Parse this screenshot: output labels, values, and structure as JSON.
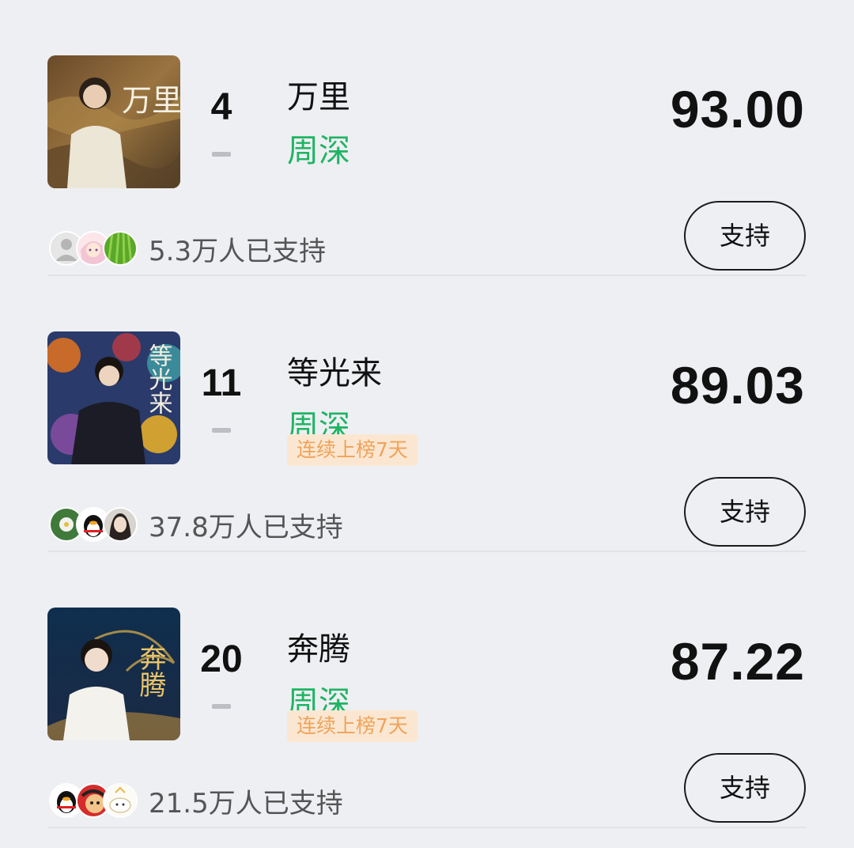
{
  "items": [
    {
      "rank": "4",
      "title": "万里",
      "artist": "周深",
      "streak": "",
      "score": "93.00",
      "supporters": "5.3万人已支持",
      "button_label": "支持",
      "cover_title": "万里",
      "avatar_icons": [
        "default-user-avatar",
        "anime-girl-avatar",
        "green-grass-avatar"
      ]
    },
    {
      "rank": "11",
      "title": "等光来",
      "artist": "周深",
      "streak": "连续上榜7天",
      "score": "89.03",
      "supporters": "37.8万人已支持",
      "button_label": "支持",
      "cover_title": "等光来",
      "avatar_icons": [
        "flower-avatar",
        "penguin-avatar",
        "girl-photo-avatar"
      ]
    },
    {
      "rank": "20",
      "title": "奔腾",
      "artist": "周深",
      "streak": "连续上榜7天",
      "score": "87.22",
      "supporters": "21.5万人已支持",
      "button_label": "支持",
      "cover_title": "奔腾",
      "avatar_icons": [
        "penguin-avatar",
        "red-cartoon-avatar",
        "cute-cloud-avatar"
      ]
    }
  ],
  "colors": {
    "background": "#eeeff3",
    "artist_green": "#1fb463",
    "streak_bg": "#fbe7d1",
    "streak_text": "#f0a35a"
  }
}
